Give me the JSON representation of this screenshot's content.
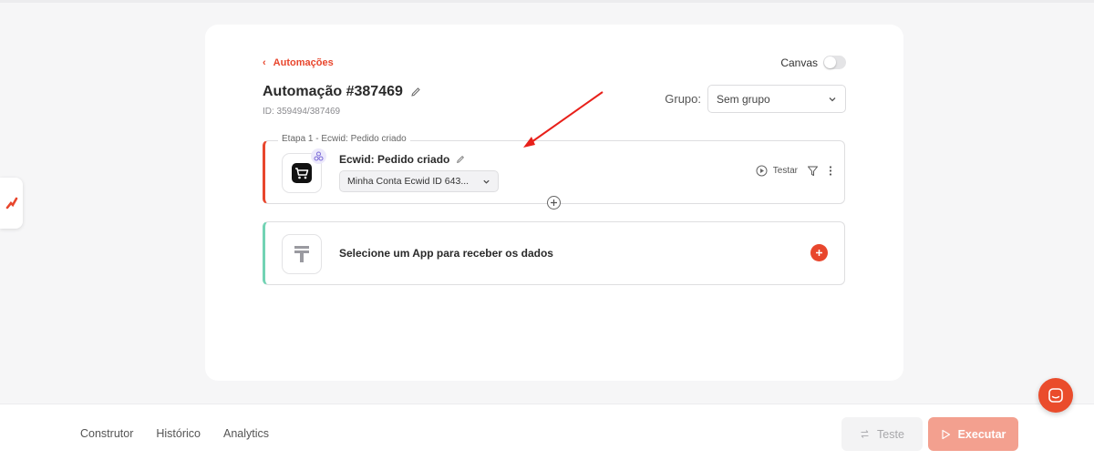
{
  "header": {
    "back_label": "Automações",
    "canvas_label": "Canvas",
    "title": "Automação #387469",
    "id_text": "ID: 359494/387469",
    "group_label": "Grupo:",
    "group_value": "Sem grupo"
  },
  "steps": [
    {
      "caption": "Etapa 1 - Ecwid: Pedido criado",
      "title": "Ecwid: Pedido criado",
      "account": "Minha Conta Ecwid ID 643...",
      "test_label": "Testar"
    },
    {
      "title": "Selecione um App para receber os dados"
    }
  ],
  "footer": {
    "tabs": [
      "Construtor",
      "Histórico",
      "Analytics"
    ],
    "test_button": "Teste",
    "run_button": "Executar"
  },
  "colors": {
    "accent": "#e8462d",
    "step2_border": "#72d3b4"
  }
}
